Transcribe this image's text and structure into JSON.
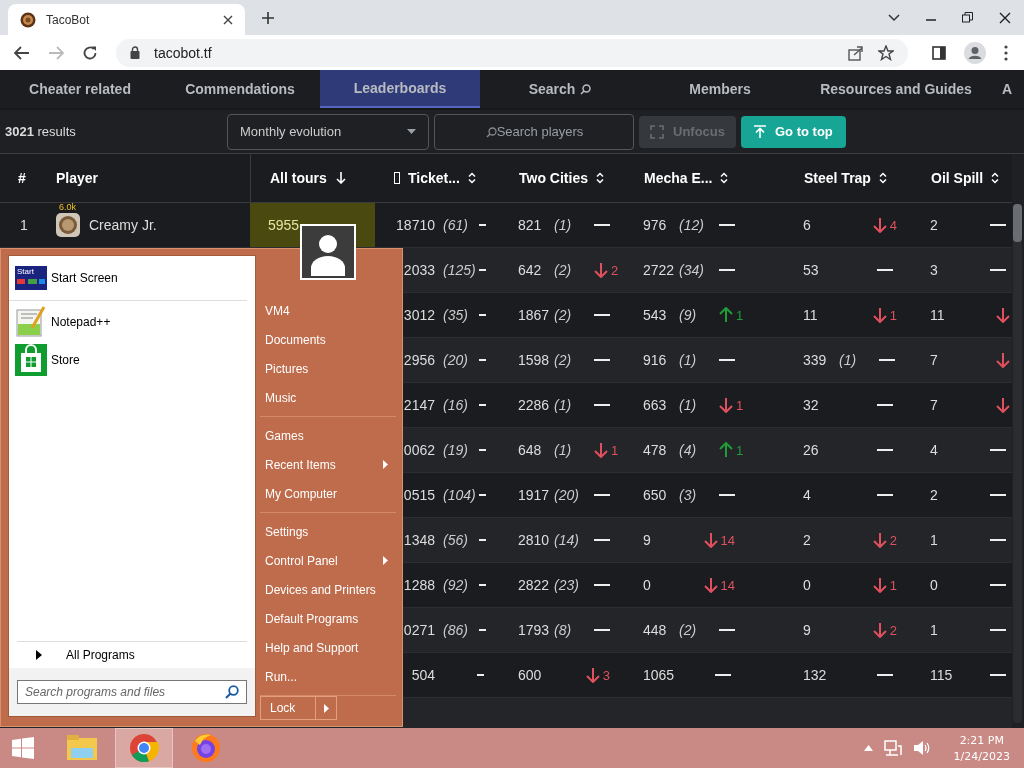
{
  "browser": {
    "tab": {
      "title": "TacoBot"
    },
    "address": "tacobot.tf"
  },
  "nav": [
    {
      "label": "Cheater related",
      "selected": false,
      "kind": "link"
    },
    {
      "label": "Commendations",
      "selected": false,
      "kind": "link"
    },
    {
      "label": "Leaderboards",
      "selected": true,
      "kind": "link"
    },
    {
      "label": "Search",
      "selected": false,
      "kind": "search"
    },
    {
      "label": "Members",
      "selected": false,
      "kind": "link"
    },
    {
      "label": "Resources and Guides",
      "selected": false,
      "kind": "link"
    },
    {
      "label": "A",
      "selected": false,
      "kind": "link"
    }
  ],
  "toolbar": {
    "count": "3021",
    "count_label": "results",
    "view": "Monthly evolution",
    "search": {
      "placeholder": "Search players"
    },
    "buttons": [
      {
        "label": "Unfocus",
        "kind": "unfocus",
        "disabled": true
      },
      {
        "label": "Go to top",
        "kind": "top",
        "disabled": false
      }
    ]
  },
  "table": {
    "columns": [
      {
        "label": "#",
        "sortable": false,
        "sorted": false
      },
      {
        "label": "Player",
        "sortable": false,
        "sorted": false
      },
      {
        "label": "All tours",
        "sorted": true
      },
      {
        "label": "Ticket...",
        "sortable": true,
        "sorted": false,
        "missing_glyph": true
      },
      {
        "label": "Two Cities",
        "sortable": true,
        "sorted": false
      },
      {
        "label": "Mecha E...",
        "sortable": true,
        "sorted": false
      },
      {
        "label": "Steel Trap",
        "sortable": true,
        "sorted": false
      },
      {
        "label": "Oil Spill",
        "sortable": true,
        "sorted": false
      }
    ],
    "rows": [
      {
        "cells": [
          "1",
          {
            "badge": "6.0k",
            "name": "Creamy Jr."
          },
          {
            "value": "5955"
          },
          {
            "value": "18710",
            "count": "(61)",
            "trend": {
              "kind": "same"
            }
          },
          {
            "value": "821",
            "count": "(1)",
            "trend": {
              "kind": "same"
            }
          },
          {
            "value": "976",
            "count": "(12)",
            "trend": {
              "kind": "same"
            }
          },
          {
            "value": "6",
            "trend": {
              "kind": "down",
              "amount": "4"
            }
          },
          {
            "value": "2",
            "trend": {
              "kind": "same"
            }
          }
        ]
      },
      {
        "cells": [
          "",
          "",
          "",
          {
            "value": "2033",
            "count": "(125)",
            "trend": {
              "kind": "same"
            }
          },
          {
            "value": "642",
            "count": "(2)",
            "trend": {
              "kind": "down",
              "amount": "2"
            }
          },
          {
            "value": "2722",
            "count": "(34)",
            "trend": {
              "kind": "same"
            }
          },
          {
            "value": "53",
            "trend": {
              "kind": "same"
            }
          },
          {
            "value": "3",
            "trend": {
              "kind": "same"
            }
          }
        ]
      },
      {
        "cells": [
          "",
          "",
          "",
          {
            "value": "3012",
            "count": "(35)",
            "trend": {
              "kind": "same"
            }
          },
          {
            "value": "1867",
            "count": "(2)",
            "trend": {
              "kind": "same"
            }
          },
          {
            "value": "543",
            "count": "(9)",
            "trend": {
              "kind": "up",
              "amount": "1"
            }
          },
          {
            "value": "11",
            "trend": {
              "kind": "down",
              "amount": "1"
            }
          },
          {
            "value": "11",
            "trend": {
              "kind": "down"
            }
          }
        ]
      },
      {
        "cells": [
          "",
          "",
          "",
          {
            "value": "2956",
            "count": "(20)",
            "trend": {
              "kind": "same"
            }
          },
          {
            "value": "1598",
            "count": "(2)",
            "trend": {
              "kind": "same"
            }
          },
          {
            "value": "916",
            "count": "(1)",
            "trend": {
              "kind": "same"
            }
          },
          {
            "value": "339",
            "count": "(1)",
            "trend": {
              "kind": "same"
            }
          },
          {
            "value": "7",
            "trend": {
              "kind": "down"
            }
          }
        ]
      },
      {
        "cells": [
          "",
          "",
          "",
          {
            "value": "2147",
            "count": "(16)",
            "trend": {
              "kind": "same"
            }
          },
          {
            "value": "2286",
            "count": "(1)",
            "trend": {
              "kind": "same"
            }
          },
          {
            "value": "663",
            "count": "(1)",
            "trend": {
              "kind": "down",
              "amount": "1"
            }
          },
          {
            "value": "32",
            "trend": {
              "kind": "same"
            }
          },
          {
            "value": "7",
            "trend": {
              "kind": "down"
            }
          }
        ]
      },
      {
        "cells": [
          "",
          "",
          "",
          {
            "value": "0062",
            "count": "(19)",
            "trend": {
              "kind": "same"
            }
          },
          {
            "value": "648",
            "count": "(1)",
            "trend": {
              "kind": "down",
              "amount": "1"
            }
          },
          {
            "value": "478",
            "count": "(4)",
            "trend": {
              "kind": "up",
              "amount": "1"
            }
          },
          {
            "value": "26",
            "trend": {
              "kind": "same"
            }
          },
          {
            "value": "4",
            "trend": {
              "kind": "same"
            }
          }
        ]
      },
      {
        "cells": [
          "",
          "",
          "",
          {
            "value": "0515",
            "count": "(104)",
            "trend": {
              "kind": "same"
            }
          },
          {
            "value": "1917",
            "count": "(20)",
            "trend": {
              "kind": "same"
            }
          },
          {
            "value": "650",
            "count": "(3)",
            "trend": {
              "kind": "same"
            }
          },
          {
            "value": "4",
            "trend": {
              "kind": "same"
            }
          },
          {
            "value": "2",
            "trend": {
              "kind": "same"
            }
          }
        ]
      },
      {
        "cells": [
          "",
          "",
          "",
          {
            "value": "1348",
            "count": "(56)",
            "trend": {
              "kind": "same"
            }
          },
          {
            "value": "2810",
            "count": "(14)",
            "trend": {
              "kind": "same"
            }
          },
          {
            "value": "9",
            "trend": {
              "kind": "down",
              "amount": "14"
            }
          },
          {
            "value": "2",
            "trend": {
              "kind": "down",
              "amount": "2"
            }
          },
          {
            "value": "1",
            "trend": {
              "kind": "same"
            }
          }
        ]
      },
      {
        "cells": [
          "",
          "",
          "",
          {
            "value": "1288",
            "count": "(92)",
            "trend": {
              "kind": "same"
            }
          },
          {
            "value": "2822",
            "count": "(23)",
            "trend": {
              "kind": "same"
            }
          },
          {
            "value": "0",
            "trend": {
              "kind": "down",
              "amount": "14"
            }
          },
          {
            "value": "0",
            "trend": {
              "kind": "down",
              "amount": "1"
            }
          },
          {
            "value": "0",
            "trend": {
              "kind": "same"
            }
          }
        ]
      },
      {
        "cells": [
          "",
          "",
          "",
          {
            "value": "0271",
            "count": "(86)",
            "trend": {
              "kind": "same"
            }
          },
          {
            "value": "1793",
            "count": "(8)",
            "trend": {
              "kind": "same"
            }
          },
          {
            "value": "448",
            "count": "(2)",
            "trend": {
              "kind": "same"
            }
          },
          {
            "value": "9",
            "trend": {
              "kind": "down",
              "amount": "2"
            }
          },
          {
            "value": "1",
            "trend": {
              "kind": "same"
            }
          }
        ]
      },
      {
        "cells": [
          "",
          "",
          "",
          {
            "value": "504",
            "trend": {
              "kind": "same"
            }
          },
          {
            "value": "600",
            "trend": {
              "kind": "down",
              "amount": "3"
            }
          },
          {
            "value": "1065",
            "trend": {
              "kind": "same"
            }
          },
          {
            "value": "132",
            "trend": {
              "kind": "same"
            }
          },
          {
            "value": "115",
            "trend": {
              "kind": "same"
            }
          }
        ]
      }
    ]
  },
  "start_menu": {
    "program_groups": [
      {
        "items": [
          {
            "label": "Start Screen",
            "kind": "start_screen",
            "icon_label": "Start"
          }
        ]
      },
      {
        "items": [
          {
            "label": "Notepad++",
            "kind": "notepad"
          },
          {
            "label": "Store",
            "kind": "store"
          }
        ]
      }
    ],
    "all_programs": "All Programs",
    "search": {
      "placeholder": "Search programs and files"
    },
    "place_groups": [
      {
        "items": [
          {
            "label": "VM4",
            "submenu": false
          },
          {
            "label": "Documents",
            "submenu": false
          },
          {
            "label": "Pictures",
            "submenu": false
          },
          {
            "label": "Music",
            "submenu": false
          }
        ]
      },
      {
        "items": [
          {
            "label": "Games",
            "submenu": false
          },
          {
            "label": "Recent Items",
            "submenu": true
          },
          {
            "label": "My Computer",
            "submenu": false
          }
        ]
      },
      {
        "items": [
          {
            "label": "Settings",
            "submenu": false
          },
          {
            "label": "Control Panel",
            "submenu": true
          },
          {
            "label": "Devices and Printers",
            "submenu": false
          },
          {
            "label": "Default Programs",
            "submenu": false
          },
          {
            "label": "Help and Support",
            "submenu": false
          },
          {
            "label": "Run...",
            "submenu": false
          }
        ]
      }
    ],
    "power": {
      "label": "Lock"
    }
  },
  "taskbar": {
    "apps": [
      {
        "kind": "explorer",
        "selected": false
      },
      {
        "kind": "chrome",
        "selected": true
      },
      {
        "kind": "firefox",
        "selected": false
      }
    ],
    "time": "2:21 PM",
    "date": "1/24/2023"
  }
}
